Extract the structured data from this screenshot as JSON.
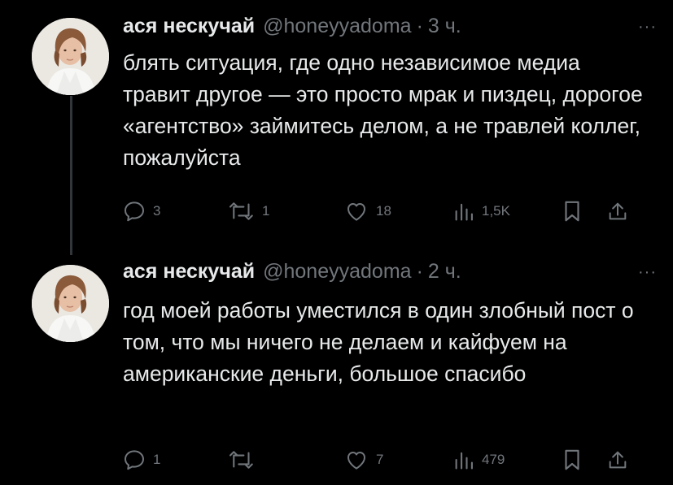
{
  "tweets": [
    {
      "author_name": "ася нескучай",
      "handle": "@honeyyadoma",
      "separator": "·",
      "time": "3 ч.",
      "more": "···",
      "text": "блять ситуация, где одно независимое медиа травит другое — это просто мрак и пиздец, дорогое «агентство» займитесь делом, а не травлей коллег, пожалуйста",
      "replies": "3",
      "reposts": "1",
      "likes": "18",
      "views": "1,5K"
    },
    {
      "author_name": "ася нескучай",
      "handle": "@honeyyadoma",
      "separator": "·",
      "time": "2 ч.",
      "more": "···",
      "text": "год моей работы уместился в один злобный пост о том, что мы ничего не делаем и кайфуем на американские деньги, большое спасибо",
      "replies": "1",
      "reposts": "",
      "likes": "7",
      "views": "479"
    }
  ],
  "icons": {
    "reply": "reply-icon",
    "repost": "repost-icon",
    "like": "heart-icon",
    "views": "views-icon",
    "bookmark": "bookmark-icon",
    "share": "share-icon"
  },
  "colors": {
    "background": "#000000",
    "text": "#e7e9ea",
    "muted": "#71767b",
    "thread_line": "#333639"
  }
}
